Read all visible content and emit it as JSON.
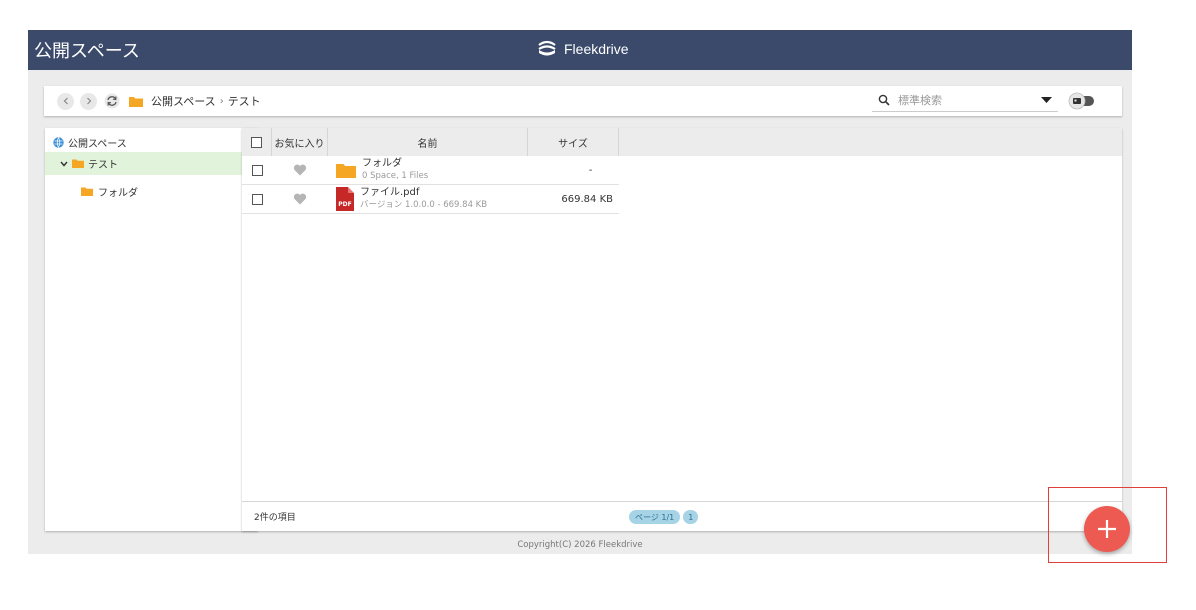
{
  "header": {
    "title": "公開スペース",
    "brand": "Fleekdrive"
  },
  "toolbar": {
    "breadcrumbs": [
      "公開スペース",
      "テスト"
    ],
    "breadcrumb_separator": "›",
    "search_placeholder": "標準検索"
  },
  "tree": {
    "root": "公開スペース",
    "selected": "テスト",
    "child": "フォルダ"
  },
  "table": {
    "headers": {
      "favorite": "お気に入り",
      "name": "名前",
      "size": "サイズ"
    },
    "rows": [
      {
        "icon": "folder-icon",
        "name": "フォルダ",
        "sub": "0 Space, 1 Files",
        "size": "-"
      },
      {
        "icon": "pdf-icon",
        "name": "ファイル.pdf",
        "sub": "バージョン 1.0.0.0 - 669.84 KB",
        "size": "669.84 KB"
      }
    ]
  },
  "footer": {
    "count": "2件の項目",
    "page_label": "ページ 1/1",
    "page_number": "1"
  },
  "copyright": "Copyright(C) 2026 Fleekdrive",
  "colors": {
    "header_bg": "#3b4a6b",
    "folder": "#f5a623",
    "pdf": "#c62828",
    "fab": "#ec5a52",
    "tree_selected": "#e2f3dc",
    "pager": "#a6d3e6",
    "highlight": "#e0403a"
  }
}
